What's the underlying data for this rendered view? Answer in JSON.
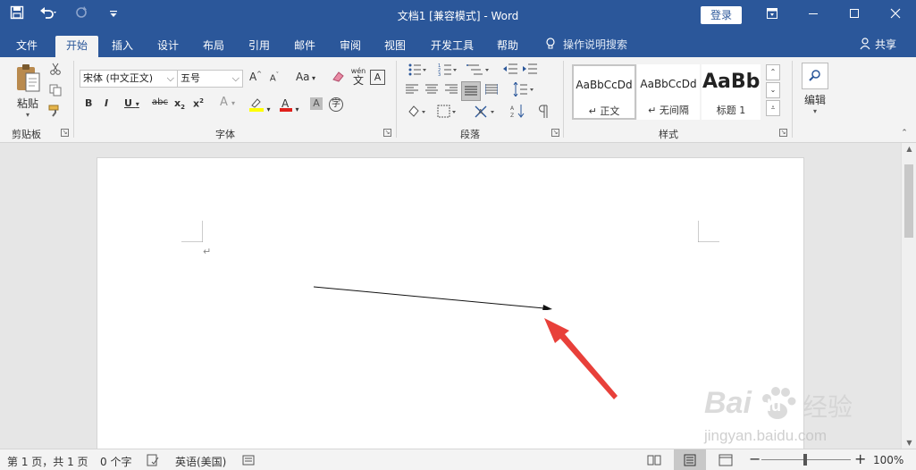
{
  "window": {
    "title": "文档1 [兼容模式] - Word",
    "login_label": "登录"
  },
  "tabs": [
    {
      "label": "文件"
    },
    {
      "label": "开始"
    },
    {
      "label": "插入"
    },
    {
      "label": "设计"
    },
    {
      "label": "布局"
    },
    {
      "label": "引用"
    },
    {
      "label": "邮件"
    },
    {
      "label": "审阅"
    },
    {
      "label": "视图"
    },
    {
      "label": "开发工具"
    },
    {
      "label": "帮助"
    }
  ],
  "active_tab": "开始",
  "tell_me": "操作说明搜索",
  "share_label": "共享",
  "ribbon": {
    "clipboard": {
      "label": "剪贴板",
      "paste_label": "粘贴"
    },
    "font": {
      "label": "字体",
      "font_name": "宋体 (中文正文)",
      "font_size": "五号",
      "font_color": "#e0201b",
      "highlight_color": "#ffff00",
      "phonetic": "wén",
      "change_case": "Aa"
    },
    "paragraph": {
      "label": "段落"
    },
    "styles": {
      "label": "样式",
      "items": [
        {
          "sample": "AaBbCcDd",
          "name": "↵ 正文"
        },
        {
          "sample": "AaBbCcDd",
          "name": "↵ 无间隔"
        },
        {
          "sample": "AaBb",
          "name": "标题 1"
        }
      ]
    },
    "editing": {
      "label": "编辑"
    }
  },
  "statusbar": {
    "page": "第 1 页，共 1 页",
    "words": "0 个字",
    "language": "英语(美国)",
    "zoom": "100%"
  },
  "watermark": {
    "brand": "Bai",
    "brand2": "du",
    "suffix": "经验",
    "url": "jingyan.baidu.com"
  },
  "colors": {
    "accent": "#2b579a",
    "annotation_arrow": "#e8403a"
  }
}
